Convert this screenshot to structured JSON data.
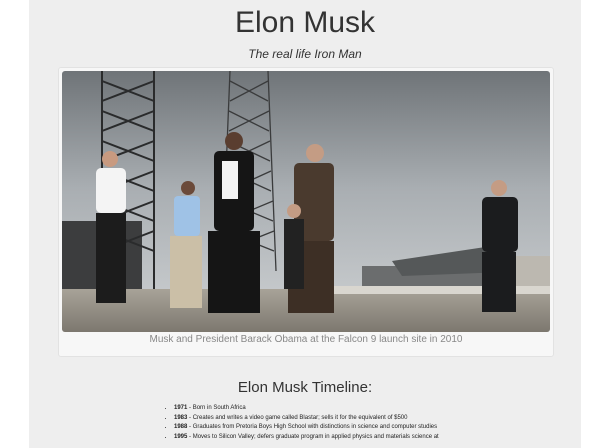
{
  "page": {
    "title": "Elon Musk",
    "subtitle": "The real life Iron Man"
  },
  "figure": {
    "caption": "Musk and President Barack Obama at the Falcon 9 launch site in 2010"
  },
  "timeline": {
    "heading": "Elon Musk Timeline:",
    "items": [
      {
        "year": "1971",
        "text": " - Born in South Africa"
      },
      {
        "year": "1983",
        "text": " - Creates and writes a video game called Blastar; sells it for the equivalent of $500"
      },
      {
        "year": "1988",
        "text": " - Graduates from Pretoria Boys High School with distinctions in science and computer studies"
      },
      {
        "year": "1995",
        "text": " - Moves to Silicon Valley; defers graduate program in applied physics and materials science at"
      }
    ]
  },
  "colors": {
    "background": "#eeeeee",
    "text": "#333333",
    "caption": "#888888"
  }
}
